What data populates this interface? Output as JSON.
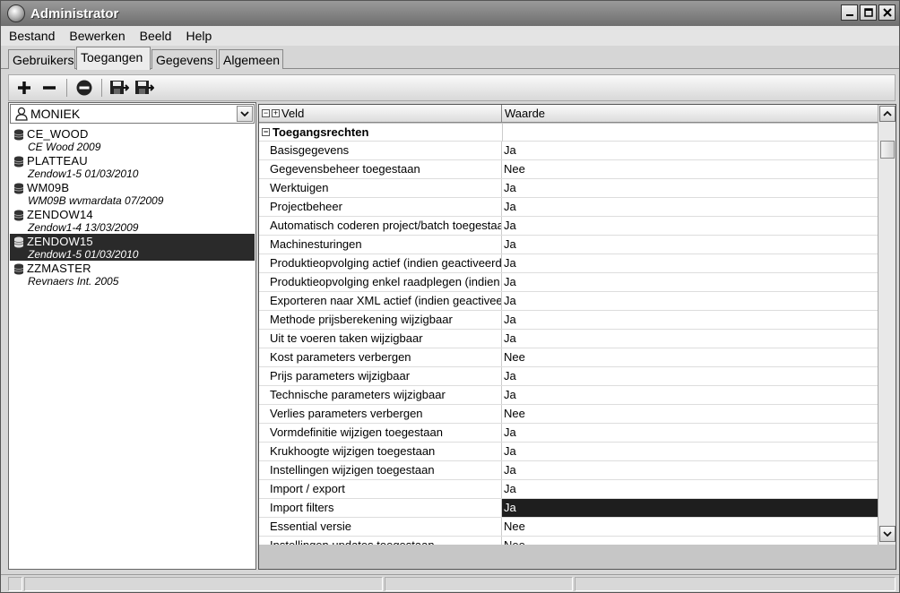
{
  "window": {
    "title": "Administrator"
  },
  "menu": {
    "items": [
      "Bestand",
      "Bewerken",
      "Beeld",
      "Help"
    ]
  },
  "tabs": [
    {
      "label": "Gebruikers",
      "active": false
    },
    {
      "label": "Toegangen",
      "active": true
    },
    {
      "label": "Gegevens",
      "active": false
    },
    {
      "label": "Algemeen",
      "active": false
    }
  ],
  "toolbar": {
    "buttons": [
      "add-icon",
      "remove-icon",
      "delete-icon",
      "save-icon",
      "save-as-icon"
    ]
  },
  "user_select": {
    "value": "MONIEK"
  },
  "databases": [
    {
      "name": "CE_WOOD",
      "desc": "CE Wood 2009",
      "selected": false
    },
    {
      "name": "PLATTEAU",
      "desc": "Zendow1-5 01/03/2010",
      "selected": false
    },
    {
      "name": "WM09B",
      "desc": "WM09B wvmardata 07/2009",
      "selected": false
    },
    {
      "name": "ZENDOW14",
      "desc": "Zendow1-4 13/03/2009",
      "selected": false
    },
    {
      "name": "ZENDOW15",
      "desc": "Zendow1-5 01/03/2010",
      "selected": true
    },
    {
      "name": "ZZMASTER",
      "desc": "Revnaers Int. 2005",
      "selected": false
    }
  ],
  "grid": {
    "col_field": "Veld",
    "col_value": "Waarde",
    "group": "Toegangsrechten",
    "rows": [
      {
        "key": "Basisgegevens",
        "val": "Ja"
      },
      {
        "key": "Gegevensbeheer toegestaan",
        "val": "Nee"
      },
      {
        "key": "Werktuigen",
        "val": "Ja"
      },
      {
        "key": "Projectbeheer",
        "val": "Ja"
      },
      {
        "key": "Automatisch coderen project/batch toegestaan",
        "val": "Ja"
      },
      {
        "key": "Machinesturingen",
        "val": "Ja"
      },
      {
        "key": "Produktieopvolging actief (indien geactiveerd)",
        "val": "Ja"
      },
      {
        "key": "Produktieopvolging enkel raadplegen (indien geactiveerd)",
        "val": "Ja"
      },
      {
        "key": "Exporteren naar XML actief (indien geactiveerd)",
        "val": "Ja"
      },
      {
        "key": "Methode prijsberekening wijzigbaar",
        "val": "Ja"
      },
      {
        "key": "Uit te voeren taken wijzigbaar",
        "val": "Ja"
      },
      {
        "key": "Kost parameters verbergen",
        "val": "Nee"
      },
      {
        "key": "Prijs parameters wijzigbaar",
        "val": "Ja"
      },
      {
        "key": "Technische parameters wijzigbaar",
        "val": "Ja"
      },
      {
        "key": "Verlies parameters verbergen",
        "val": "Nee"
      },
      {
        "key": "Vormdefinitie wijzigen toegestaan",
        "val": "Ja"
      },
      {
        "key": "Krukhoogte wijzigen toegestaan",
        "val": "Ja"
      },
      {
        "key": "Instellingen wijzigen toegestaan",
        "val": "Ja"
      },
      {
        "key": "Import / export",
        "val": "Ja"
      },
      {
        "key": "Import filters",
        "val": "Ja",
        "selected": true
      },
      {
        "key": "Essential versie",
        "val": "Nee"
      },
      {
        "key": "Instellingen updates toegestaan",
        "val": "Nee"
      }
    ]
  }
}
